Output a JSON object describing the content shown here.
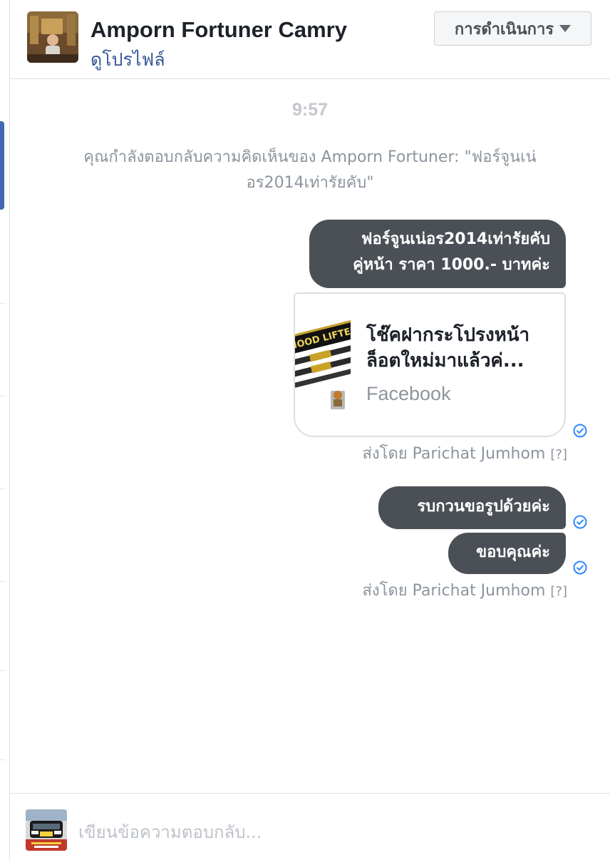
{
  "header": {
    "contact_name": "Amporn Fortuner Camry",
    "view_profile": "ดูโปรไฟล์",
    "actions_label": "การดำเนินการ"
  },
  "conversation": {
    "time": "9:57",
    "reply_context": "คุณกำลังตอบกลับความคิดเห็นของ Amporn Fortuner: \"ฟอร์จูนเน่อร2014เท่ารัยคับ\"",
    "message1": {
      "line1": "ฟอร์จูนเน่อร2014เท่ารัยคับ",
      "line2": "คู่หน้า ราคา 1000.- บาทค่ะ"
    },
    "link_card": {
      "title_line1": "โช๊คฝากระโปรงหน้า",
      "title_line2": "ล็อตใหม่มาแล้วค่...",
      "source": "Facebook",
      "thumb_text": "HOOD LIFTER"
    },
    "sent_by_1": {
      "text": "ส่งโดย Parichat Jumhom",
      "help": "[?]"
    },
    "message2": "รบกวนขอรูปด้วยค่ะ",
    "message3": "ขอบคุณค่ะ",
    "sent_by_2": {
      "text": "ส่งโดย Parichat Jumhom",
      "help": "[?]"
    }
  },
  "composer": {
    "placeholder": "เขียนข้อความตอบกลับ..."
  },
  "colors": {
    "bubble": "#4b4f56",
    "link": "#385898",
    "seen_check": "#2d88ff",
    "muted_text": "#8d949e"
  },
  "icons": {
    "seen": "check-circle-icon",
    "dropdown": "caret-down-icon"
  }
}
